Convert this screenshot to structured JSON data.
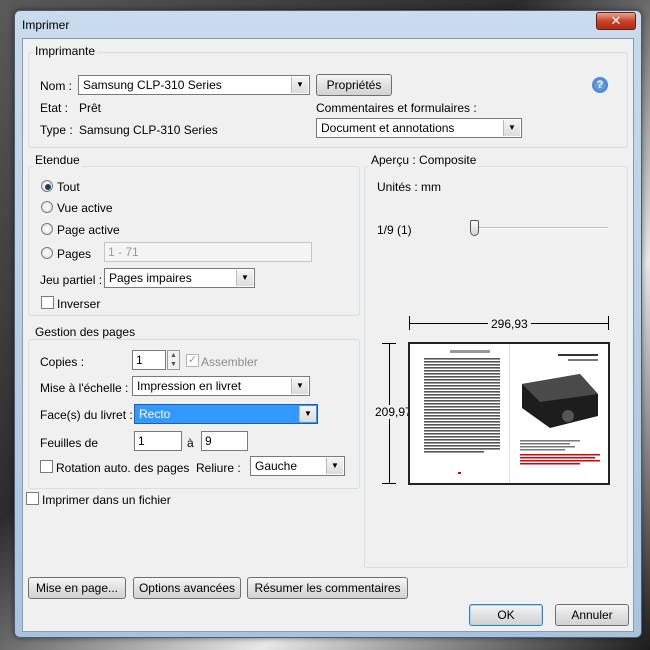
{
  "window": {
    "title": "Imprimer",
    "close_glyph": "✕"
  },
  "printer": {
    "group_label": "Imprimante",
    "name_label": "Nom :",
    "name_value": "Samsung CLP-310 Series",
    "properties_button": "Propriétés",
    "status_label": "Etat :",
    "status_value": "Prêt",
    "type_label": "Type :",
    "type_value": "Samsung CLP-310 Series",
    "comments_label": "Commentaires et formulaires :",
    "comments_value": "Document et annotations",
    "help_glyph": "?"
  },
  "range": {
    "group_label": "Etendue",
    "all_label": "Tout",
    "current_view_label": "Vue active",
    "current_page_label": "Page active",
    "pages_label": "Pages",
    "pages_value": "1 - 71",
    "subset_label": "Jeu partiel :",
    "subset_value": "Pages impaires",
    "reverse_label": "Inverser"
  },
  "page_handling": {
    "group_label": "Gestion des pages",
    "copies_label": "Copies :",
    "copies_value": "1",
    "collate_label": "Assembler",
    "scaling_label": "Mise à l'échelle :",
    "scaling_value": "Impression en livret",
    "booklet_label": "Face(s) du livret :",
    "booklet_value": "Recto",
    "sheets_label": "Feuilles de",
    "sheets_from": "1",
    "sheets_to_label": "à",
    "sheets_to": "9",
    "auto_rotate_label": "Rotation auto. des pages",
    "binding_label": "Reliure :",
    "binding_value": "Gauche"
  },
  "print_to_file_label": "Imprimer dans un fichier",
  "preview": {
    "group_label": "Aperçu : Composite",
    "units_label": "Unités : mm",
    "page_indicator": "1/9 (1)",
    "slider_position": 0,
    "width_label": "296,93",
    "height_label": "209,97"
  },
  "buttons": {
    "page_setup": "Mise en page...",
    "advanced": "Options avancées",
    "summarize": "Résumer les commentaires",
    "ok": "OK",
    "cancel": "Annuler"
  },
  "colors": {
    "selection": "#3399ff",
    "window_frame": "#a9c3de"
  }
}
